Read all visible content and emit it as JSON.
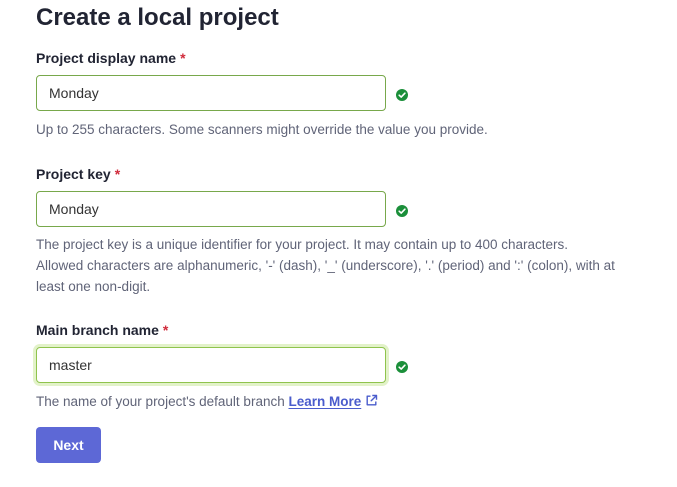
{
  "page": {
    "title": "Create a local project"
  },
  "form": {
    "required_marker": "*",
    "display_name": {
      "label": "Project display name",
      "value": "Monday",
      "help": "Up to 255 characters. Some scanners might override the value you provide.",
      "valid": true
    },
    "project_key": {
      "label": "Project key",
      "value": "Monday",
      "help_lines": [
        "The project key is a unique identifier for your project. It may contain up to 400 characters.",
        "Allowed characters are alphanumeric, '-' (dash), '_' (underscore), '.' (period) and ':' (colon), with at",
        "least one non-digit."
      ],
      "valid": true
    },
    "main_branch": {
      "label": "Main branch name",
      "value": "master",
      "help": "The name of your project's default branch",
      "learn_more": "Learn More",
      "valid": true,
      "focused": true
    },
    "next_label": "Next"
  },
  "colors": {
    "valid_check": "#1b8f3a",
    "primary_button": "#5d68d6",
    "link": "#4a5ccc",
    "required": "#d02b3b"
  },
  "icons": {
    "valid": "check-circle-icon",
    "external_link": "external-link-icon"
  }
}
